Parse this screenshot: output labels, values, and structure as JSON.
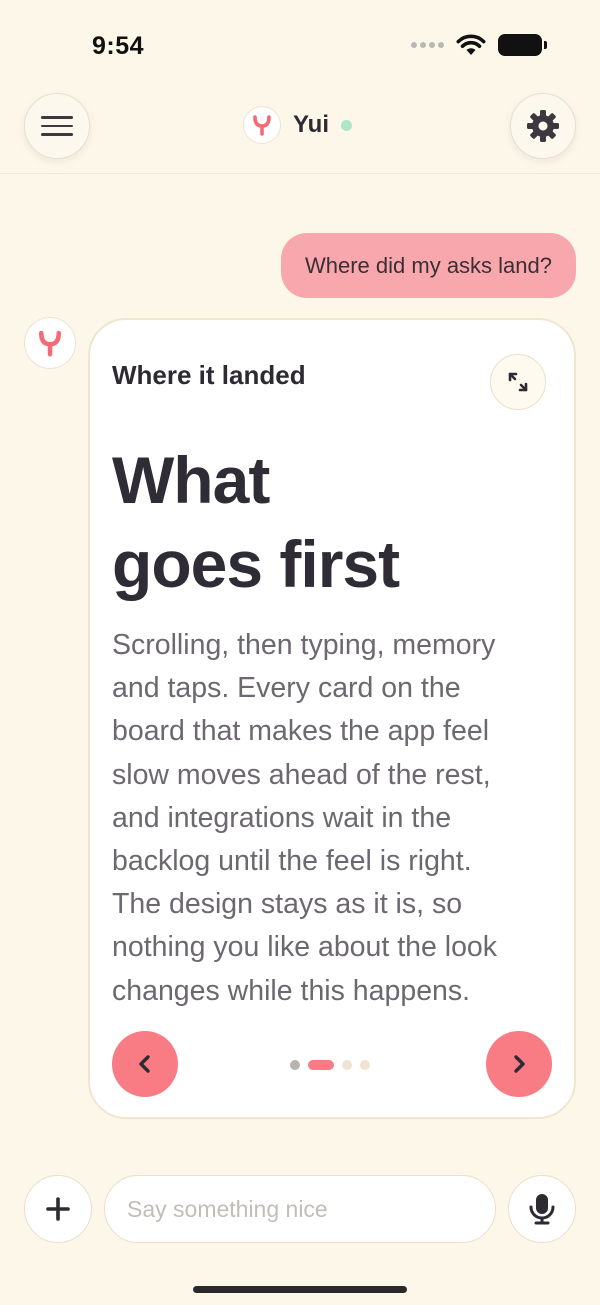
{
  "status_bar": {
    "time": "9:54"
  },
  "header": {
    "assistant_name": "Yui",
    "online_color": "#aee5c8"
  },
  "conversation": {
    "user_message": "Where did my asks land?",
    "card": {
      "kicker": "Where it landed",
      "title_line1": "What",
      "title_line2": "goes first",
      "body_lines": [
        "Scrolling, then typing, memory",
        "and taps. Every card on the",
        "board that makes the app feel",
        "slow moves ahead of the rest,",
        "and integrations wait in the",
        "backlog until the feel is right.",
        "The design stays as it is, so",
        "nothing you like about the look",
        "changes while this happens."
      ],
      "pager": {
        "total": 4,
        "current": 2
      }
    }
  },
  "composer": {
    "placeholder": "Say something nice"
  },
  "colors": {
    "accent": "#f97b84",
    "user_bubble": "#f8a8ac",
    "background": "#fdf7ea"
  },
  "icons": [
    "hamburger-menu-icon",
    "gear-icon",
    "yui-logo-icon",
    "expand-icon",
    "chevron-left-icon",
    "chevron-right-icon",
    "plus-icon",
    "microphone-icon",
    "wifi-icon",
    "battery-icon"
  ]
}
